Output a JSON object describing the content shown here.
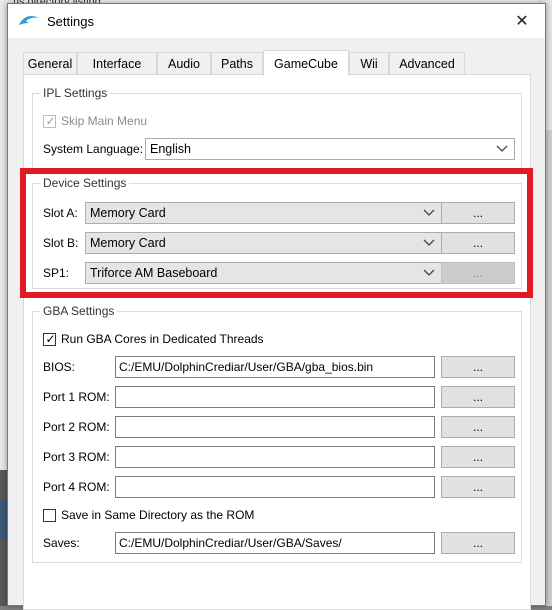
{
  "background": {
    "tab_text": "roms directory listing",
    "colors": {
      "highlight": "#e11a24",
      "accent": "#0078d7"
    }
  },
  "window": {
    "title": "Settings",
    "icons": {
      "app": "dolphin-icon",
      "close": "close-icon"
    },
    "close_glyph": "✕"
  },
  "tabs": [
    {
      "label": "General",
      "active": false
    },
    {
      "label": "Interface",
      "active": false
    },
    {
      "label": "Audio",
      "active": false
    },
    {
      "label": "Paths",
      "active": false
    },
    {
      "label": "GameCube",
      "active": true
    },
    {
      "label": "Wii",
      "active": false
    },
    {
      "label": "Advanced",
      "active": false
    }
  ],
  "ipl": {
    "title": "IPL Settings",
    "skip_main_menu": {
      "label": "Skip Main Menu",
      "checked": true,
      "enabled": false
    },
    "language_label": "System Language:",
    "language_value": "English"
  },
  "device": {
    "title": "Device Settings",
    "slots": [
      {
        "label": "Slot A:",
        "value": "Memory Card",
        "button": "...",
        "button_enabled": true
      },
      {
        "label": "Slot B:",
        "value": "Memory Card",
        "button": "...",
        "button_enabled": true
      },
      {
        "label": "SP1:",
        "value": "Triforce AM Baseboard",
        "button": "...",
        "button_enabled": false
      }
    ]
  },
  "gba": {
    "title": "GBA Settings",
    "run_threads": {
      "label": "Run GBA Cores in Dedicated Threads",
      "checked": true
    },
    "bios": {
      "label": "BIOS:",
      "value": "C:/EMU/DolphinCrediar/User/GBA/gba_bios.bin",
      "button": "..."
    },
    "ports": [
      {
        "label": "Port 1 ROM:",
        "value": "",
        "button": "..."
      },
      {
        "label": "Port 2 ROM:",
        "value": "",
        "button": "..."
      },
      {
        "label": "Port 3 ROM:",
        "value": "",
        "button": "..."
      },
      {
        "label": "Port 4 ROM:",
        "value": "",
        "button": "..."
      }
    ],
    "save_same_dir": {
      "label": "Save in Same Directory as the ROM",
      "checked": false
    },
    "saves": {
      "label": "Saves:",
      "value": "C:/EMU/DolphinCrediar/User/GBA/Saves/",
      "button": "..."
    }
  }
}
